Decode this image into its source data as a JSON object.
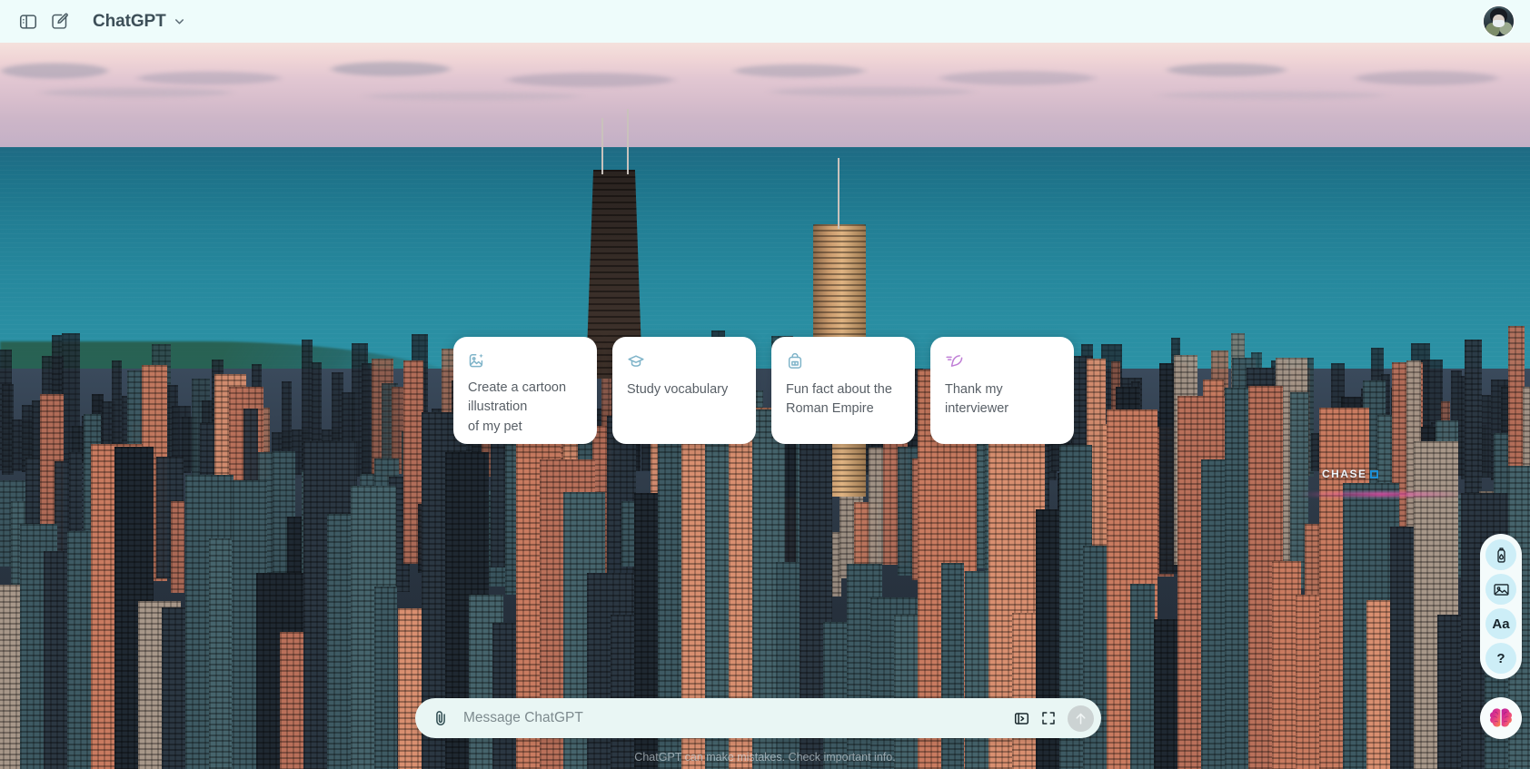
{
  "topbar": {
    "sidebar_toggle_icon": "sidebar-panel-icon",
    "new_chat_icon": "compose-pencil-icon",
    "title": "ChatGPT",
    "caret_icon": "chevron-down-icon",
    "avatar_icon": "user-avatar"
  },
  "background": {
    "description": "Aerial photograph of downtown Chicago skyline at sunset with Lake Michigan",
    "sky_color": "#e2c7d2",
    "lake_color": "#26889d",
    "sign_text": "CHASE"
  },
  "suggestions": [
    {
      "icon": "image-sparkle-icon",
      "icon_color": "#7fb4c9",
      "label": "Create a cartoon\nillustration\nof my pet"
    },
    {
      "icon": "graduation-cap-icon",
      "icon_color": "#7fb4c9",
      "label": "Study vocabulary"
    },
    {
      "icon": "backpack-icon",
      "icon_color": "#7fb4c9",
      "label": "Fun fact about the\nRoman Empire"
    },
    {
      "icon": "pen-write-icon",
      "icon_color": "#c07fd6",
      "label": "Thank my\ninterviewer"
    }
  ],
  "composer": {
    "attach_icon": "paperclip-icon",
    "placeholder": "Message ChatGPT",
    "value": "",
    "slides_icon": "panel-slide-icon",
    "expand_icon": "fullscreen-expand-icon",
    "send_icon": "arrow-up-icon"
  },
  "footer": {
    "disclaimer": "ChatGPT can make mistakes. Check important info."
  },
  "right_rail": {
    "items": [
      {
        "icon": "ink-bottle-icon",
        "name": "draw-tool"
      },
      {
        "icon": "image-icon",
        "name": "image-tool"
      },
      {
        "icon": "text-size-icon",
        "name": "text-tool",
        "glyph": "Aa"
      },
      {
        "icon": "question-mark-icon",
        "name": "help-tool",
        "glyph": "?"
      }
    ],
    "floating": {
      "icon": "brain-icon",
      "name": "ai-assistant"
    }
  }
}
